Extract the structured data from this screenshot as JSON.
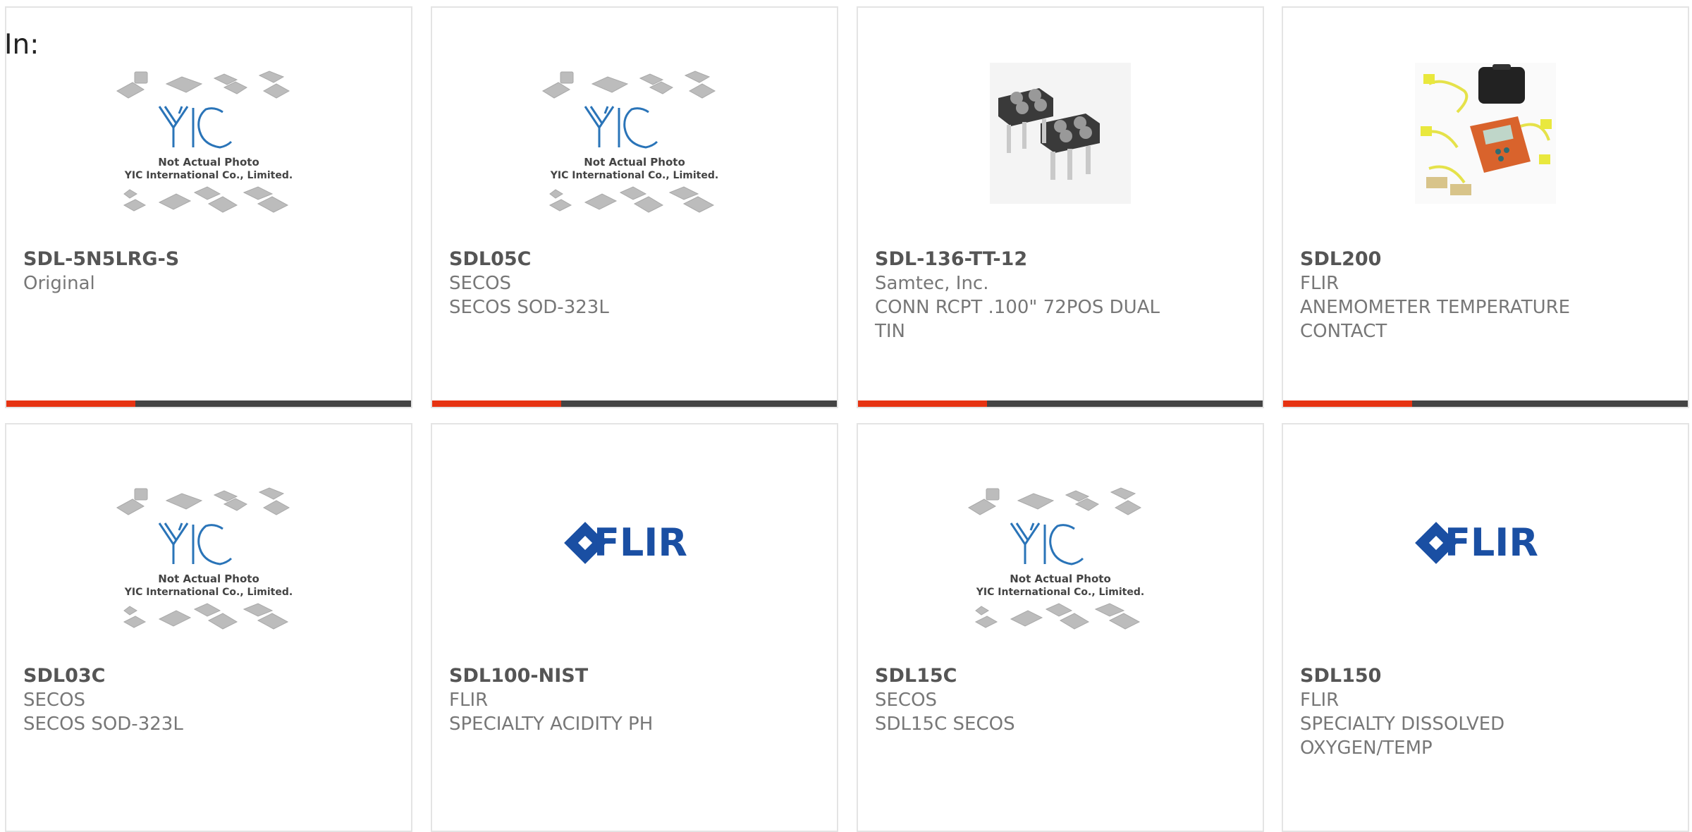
{
  "filter_label": "In:",
  "placeholder_text": {
    "line1": "Not Actual Photo",
    "line2": "YIC International Co., Limited.",
    "logo": "YIC"
  },
  "flir_logo_text": "FLIR",
  "colors": {
    "accent_red": "#e63312",
    "bar_dark": "#444444",
    "flir_blue": "#1a4fa3",
    "yic_blue": "#2a74b8"
  },
  "products": [
    {
      "part": "SDL-5N5LRG-S",
      "manufacturer": "Original",
      "description": "",
      "image": "yic-placeholder"
    },
    {
      "part": "SDL05C",
      "manufacturer": "SECOS",
      "description": "SECOS SOD-323L",
      "image": "yic-placeholder"
    },
    {
      "part": "SDL-136-TT-12",
      "manufacturer": "Samtec, Inc.",
      "description": "CONN RCPT .100\" 72POS DUAL TIN",
      "image": "connector-photo"
    },
    {
      "part": "SDL200",
      "manufacturer": "FLIR",
      "description": "ANEMOMETER TEMPERATURE CONTACT",
      "image": "meter-kit-photo"
    },
    {
      "part": "SDL03C",
      "manufacturer": "SECOS",
      "description": "SECOS SOD-323L",
      "image": "yic-placeholder"
    },
    {
      "part": "SDL100-NIST",
      "manufacturer": "FLIR",
      "description": "SPECIALTY ACIDITY PH",
      "image": "flir-logo"
    },
    {
      "part": "SDL15C",
      "manufacturer": "SECOS",
      "description": "SDL15C SECOS",
      "image": "yic-placeholder"
    },
    {
      "part": "SDL150",
      "manufacturer": "FLIR",
      "description": "SPECIALTY DISSOLVED OXYGEN/TEMP",
      "image": "flir-logo"
    }
  ]
}
